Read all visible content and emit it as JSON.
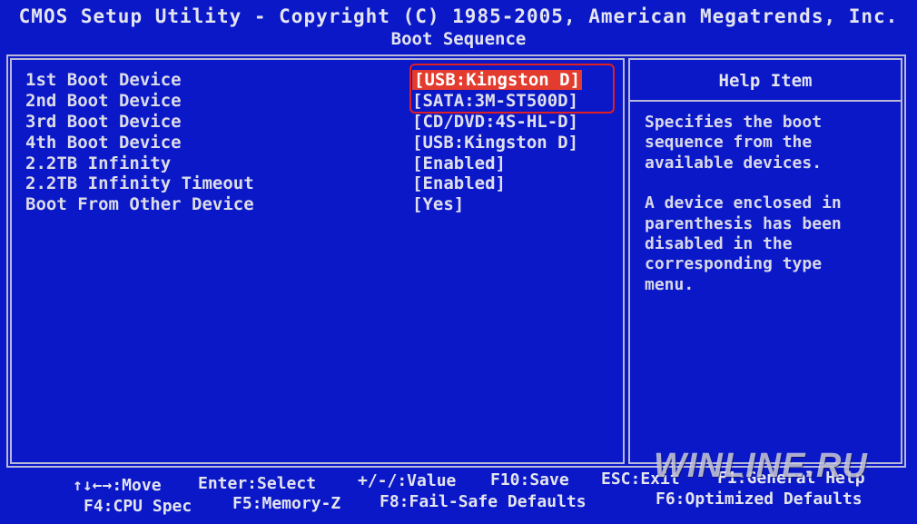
{
  "header": {
    "title": "CMOS Setup Utility - Copyright (C) 1985-2005, American Megatrends, Inc.",
    "subtitle": "Boot Sequence"
  },
  "settings": [
    {
      "label": "1st Boot Device",
      "value": "[USB:Kingston D]",
      "selected": true
    },
    {
      "label": "2nd Boot Device",
      "value": "[SATA:3M-ST500D]",
      "selected": false
    },
    {
      "label": "3rd Boot Device",
      "value": "[CD/DVD:4S-HL-D]",
      "selected": false
    },
    {
      "label": "4th Boot Device",
      "value": "[USB:Kingston D]",
      "selected": false
    },
    {
      "label": "2.2TB Infinity",
      "value": "[Enabled]",
      "selected": false
    },
    {
      "label": "2.2TB Infinity Timeout",
      "value": "[Enabled]",
      "selected": false
    },
    {
      "label": "Boot From Other Device",
      "value": "[Yes]",
      "selected": false
    }
  ],
  "help": {
    "title": "Help Item",
    "paragraph1_lines": [
      "Specifies the boot",
      "sequence from the",
      "available devices."
    ],
    "paragraph2_lines": [
      "A device enclosed in",
      "parenthesis has been",
      "disabled in the",
      "corresponding type",
      "menu."
    ]
  },
  "footer": {
    "move": "↑↓←→:Move",
    "enter": "Enter:Select",
    "value": "+/-/:Value",
    "save": "F10:Save",
    "exit": "ESC:Exit",
    "general_help": "F1:General Help",
    "cpu_spec": "F4:CPU Spec",
    "memory": "F5:Memory-Z",
    "fail_safe": "F8:Fail-Safe Defaults",
    "optimized": "F6:Optimized Defaults"
  },
  "watermark": "WINLINE.RU",
  "colors": {
    "background": "#0a18c8",
    "selected_background": "#e33b2e",
    "annotation_box": "#e02020"
  }
}
